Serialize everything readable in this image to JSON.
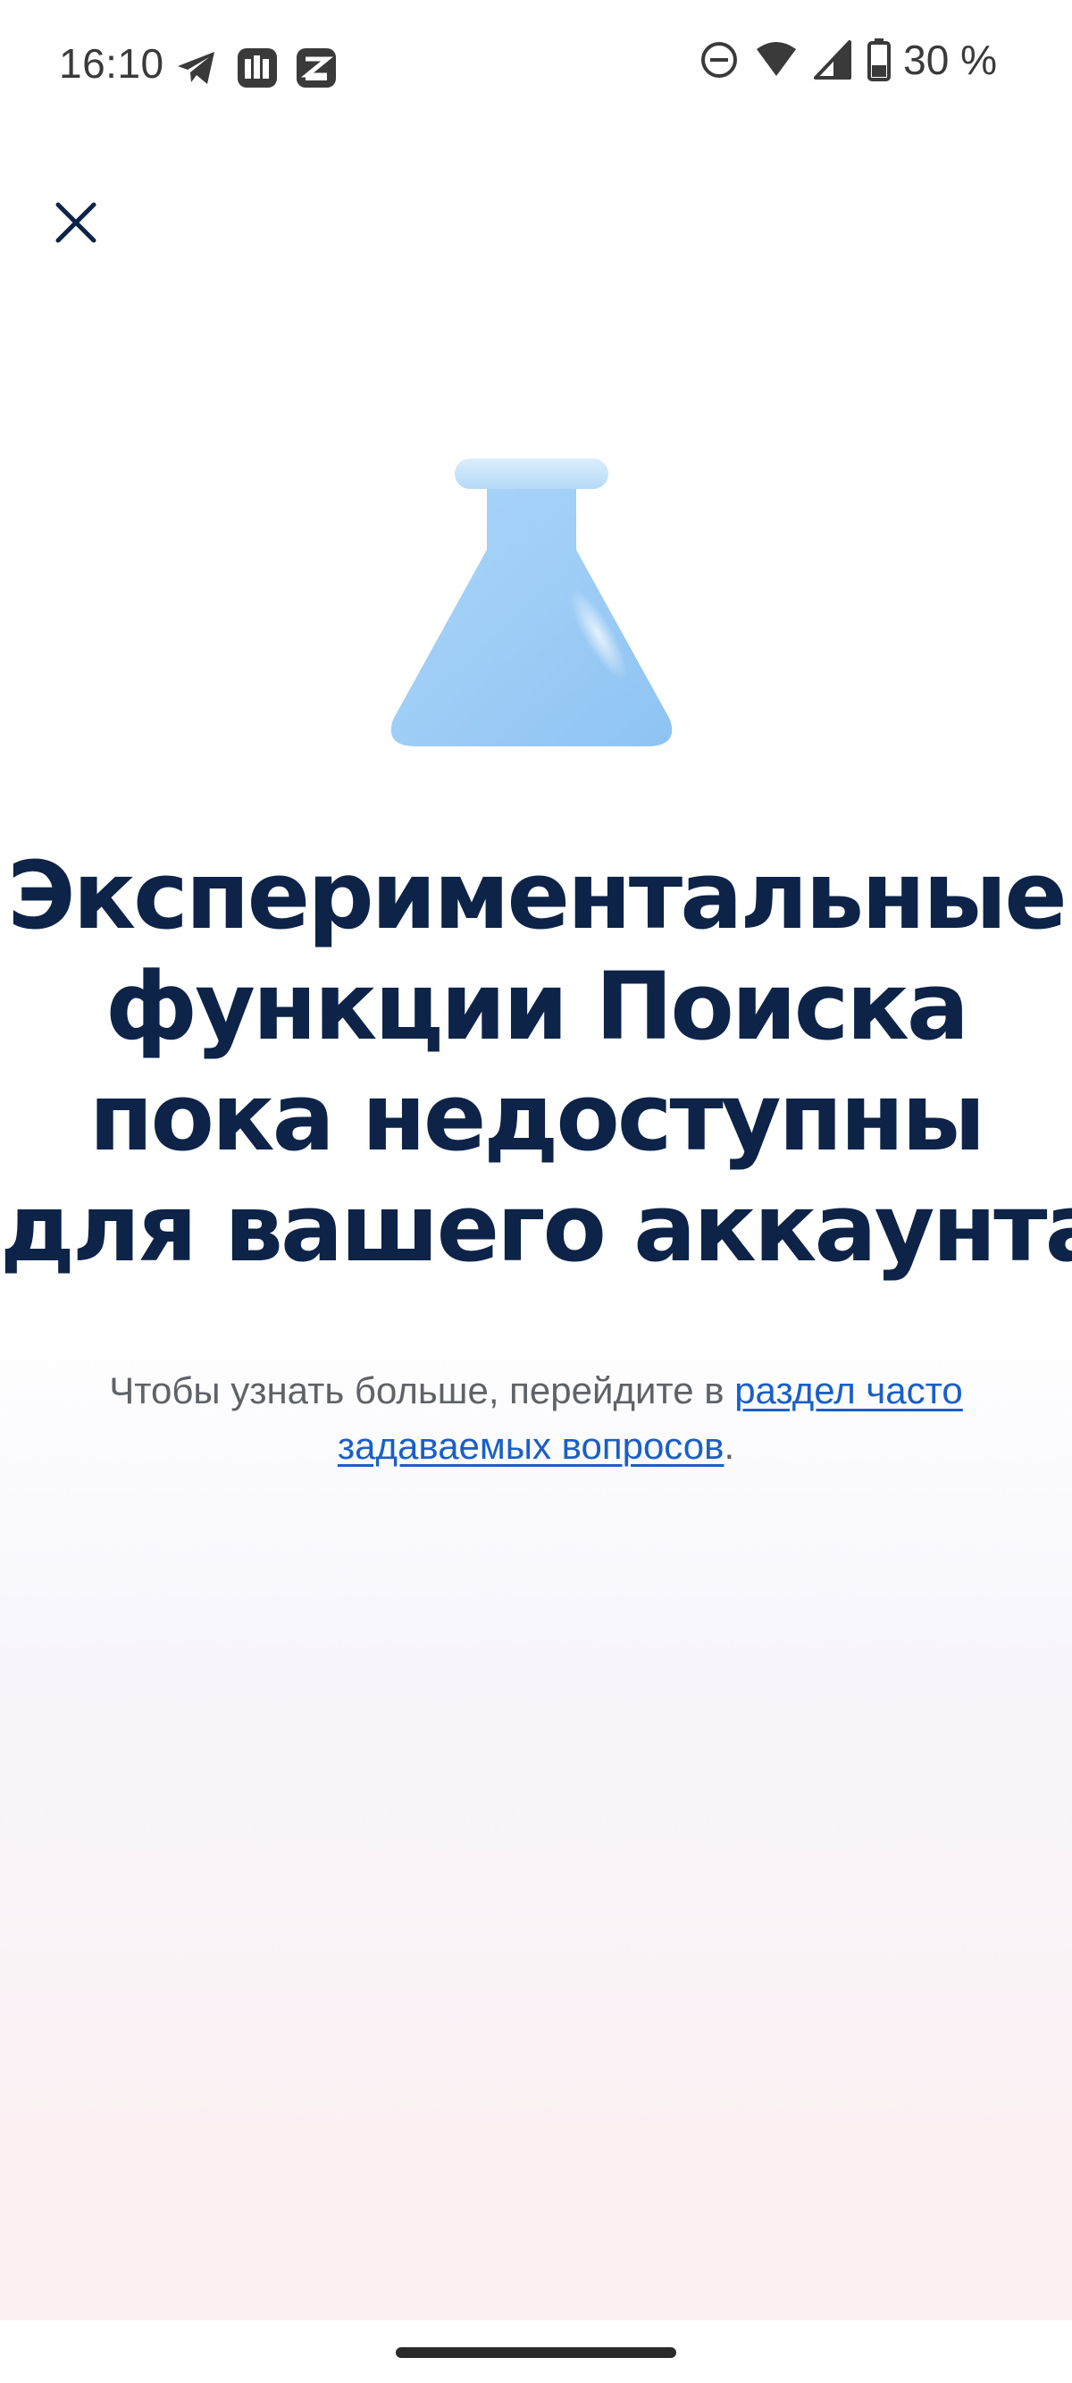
{
  "status_bar": {
    "time": "16:10",
    "battery_percent": "30 %",
    "left_icons": [
      "telegram-icon",
      "notification-app-icon",
      "notification-app-2-icon"
    ],
    "right_icons": [
      "do-not-disturb-icon",
      "wifi-icon",
      "cellular-signal-icon",
      "battery-icon"
    ]
  },
  "close_icon": "close-icon",
  "illustration_icon": "flask-icon",
  "headline": {
    "line1": "Экспериментальные",
    "line2": "функции Поиска",
    "line3": "пока недоступны",
    "line4": "для вашего аккаунта"
  },
  "subtext": {
    "prefix": "Чтобы узнать больше, перейдите в ",
    "link": "раздел часто задаваемых вопросов",
    "suffix": "."
  },
  "colors": {
    "headline": "#0d2348",
    "body_text": "#5f6368",
    "link": "#1a5fc8",
    "flask": "#9ecdf6"
  }
}
